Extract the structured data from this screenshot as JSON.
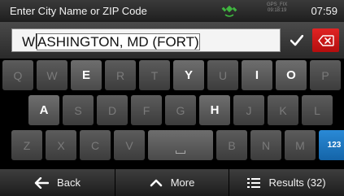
{
  "status_bar": {
    "title": "Enter City Name or ZIP Code",
    "gps_time_line1": "GPS_FIX",
    "gps_time_line2": "09:18:19",
    "clock": "07:59"
  },
  "search": {
    "typed_text": "W",
    "completion_text": "ASHINGTON, MD (FORT)"
  },
  "keyboard": {
    "rows": [
      {
        "keys": [
          {
            "label": "Q",
            "active": false
          },
          {
            "label": "W",
            "active": false
          },
          {
            "label": "E",
            "active": true
          },
          {
            "label": "R",
            "active": false
          },
          {
            "label": "T",
            "active": false
          },
          {
            "label": "Y",
            "active": true
          },
          {
            "label": "U",
            "active": false
          },
          {
            "label": "I",
            "active": true
          },
          {
            "label": "O",
            "active": true
          },
          {
            "label": "P",
            "active": false
          }
        ]
      },
      {
        "keys": [
          {
            "label": "A",
            "active": true
          },
          {
            "label": "S",
            "active": false
          },
          {
            "label": "D",
            "active": false
          },
          {
            "label": "F",
            "active": false
          },
          {
            "label": "G",
            "active": false
          },
          {
            "label": "H",
            "active": true
          },
          {
            "label": "J",
            "active": false
          },
          {
            "label": "K",
            "active": false
          },
          {
            "label": "L",
            "active": false
          }
        ]
      },
      {
        "keys": [
          {
            "label": "Z",
            "active": false
          },
          {
            "label": "X",
            "active": false
          },
          {
            "label": "C",
            "active": false
          },
          {
            "label": "V",
            "active": false
          },
          {
            "label": "",
            "type": "space",
            "active": true
          },
          {
            "label": "B",
            "active": false
          },
          {
            "label": "N",
            "active": false
          },
          {
            "label": "M",
            "active": false
          },
          {
            "label": "123",
            "type": "numeric",
            "active": true
          }
        ]
      }
    ]
  },
  "bottom_bar": {
    "back_label": "Back",
    "more_label": "More",
    "results_label": "Results (32)"
  },
  "icons": {
    "gps": "satellite-icon",
    "confirm": "checkmark-icon",
    "delete": "backspace-icon",
    "back": "left-arrow-icon",
    "more": "chevron-up-icon",
    "results": "list-icon"
  },
  "colors": {
    "delete_button": "#d01c1c",
    "numeric_key": "#1e78c2",
    "gps_icon": "#3fb53f"
  }
}
